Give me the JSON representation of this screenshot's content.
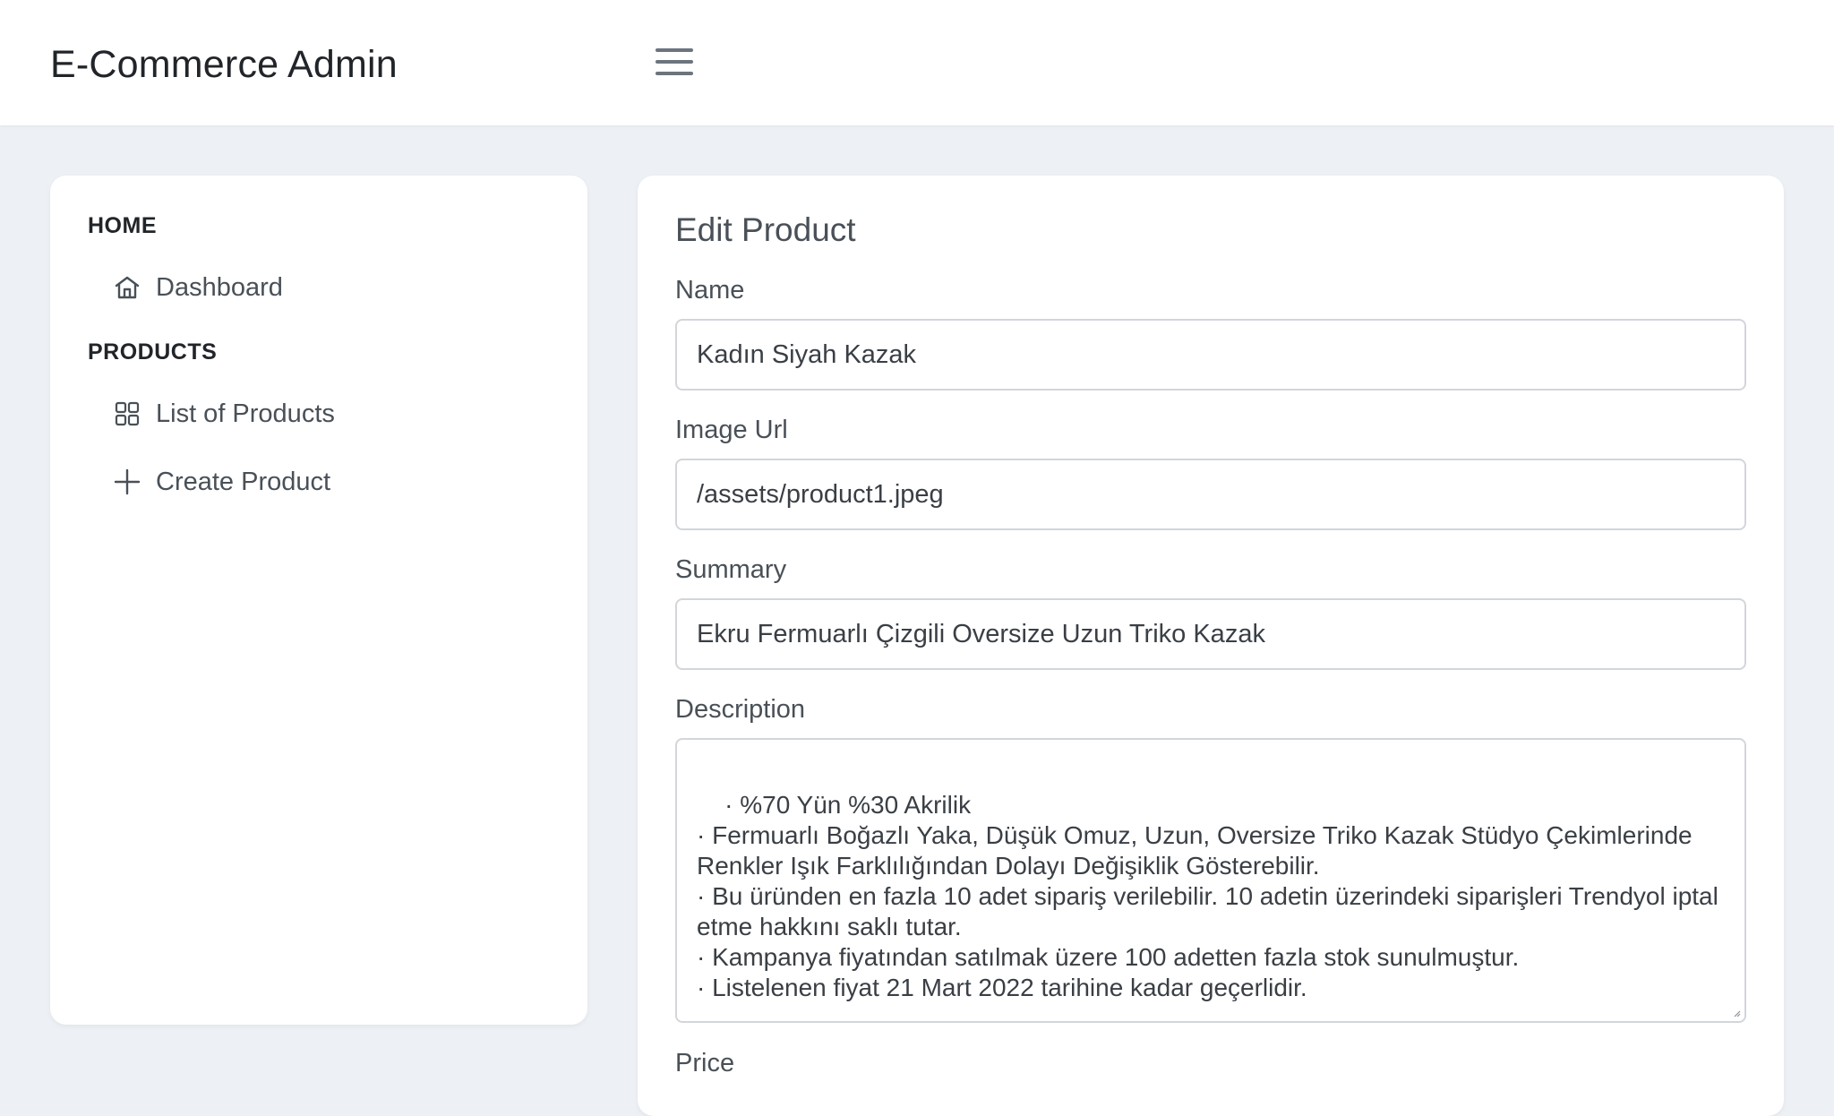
{
  "header": {
    "brand": "E-Commerce Admin",
    "menu_icon": "hamburger-menu-icon"
  },
  "sidebar": {
    "sections": [
      {
        "title": "HOME",
        "items": [
          {
            "label": "Dashboard",
            "icon": "home-icon"
          }
        ]
      },
      {
        "title": "PRODUCTS",
        "items": [
          {
            "label": "List of Products",
            "icon": "grid-icon"
          },
          {
            "label": "Create Product",
            "icon": "plus-icon"
          }
        ]
      }
    ]
  },
  "form": {
    "title": "Edit Product",
    "fields": {
      "name": {
        "label": "Name",
        "value": "Kadın Siyah Kazak"
      },
      "image_url": {
        "label": "Image Url",
        "value": "/assets/product1.jpeg"
      },
      "summary": {
        "label": "Summary",
        "value": "Ekru Fermuarlı Çizgili Oversize Uzun Triko Kazak"
      },
      "description": {
        "label": "Description",
        "value": "· %70 Yün %30 Akrilik\n· Fermuarlı Boğazlı Yaka, Düşük Omuz, Uzun, Oversize Triko Kazak Stüdyo Çekimlerinde Renkler Işık Farklılığından Dolayı Değişiklik Gösterebilir.\n· Bu üründen en fazla 10 adet sipariş verilebilir. 10 adetin üzerindeki siparişleri Trendyol iptal etme hakkını saklı tutar.\n· Kampanya fiyatından satılmak üzere 100 adetten fazla stok sunulmuştur.\n· Listelenen fiyat 21 Mart 2022 tarihine kadar geçerlidir."
      },
      "price": {
        "label": "Price"
      }
    }
  },
  "colors": {
    "background": "#edf0f4",
    "card": "#ffffff",
    "text": "#3a3f45",
    "border": "#d2d6db"
  }
}
